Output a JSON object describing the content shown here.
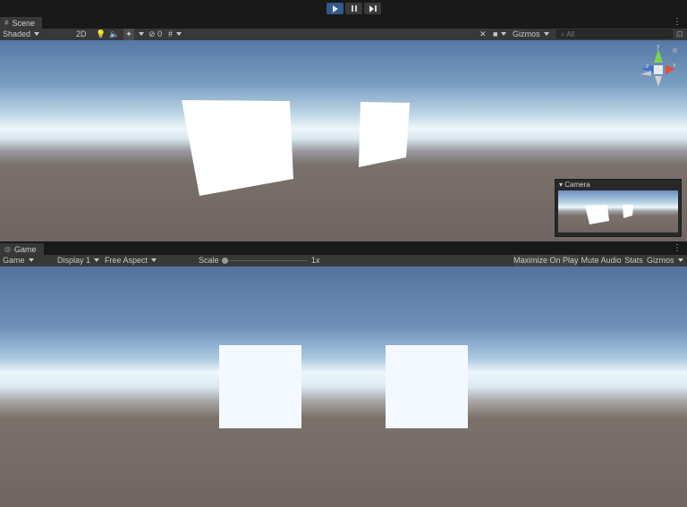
{
  "play_controls": {
    "play_label": "Play",
    "pause_label": "Pause",
    "step_label": "Step"
  },
  "scene_panel": {
    "tab_label": "Scene",
    "toolbar": {
      "shading_mode": "Shaded",
      "mode_2d": "2D",
      "hidden_count": "0",
      "gizmos_label": "Gizmos",
      "search_placeholder": "All"
    },
    "gizmo_axes": {
      "x": "x",
      "y": "y",
      "z": "z"
    },
    "camera_preview_title": "Camera"
  },
  "game_panel": {
    "tab_label": "Game",
    "toolbar": {
      "view_mode": "Game",
      "display": "Display 1",
      "aspect": "Free Aspect",
      "scale_label": "Scale",
      "scale_value": 0.0,
      "scale_readout": "1x",
      "maximize_label": "Maximize On Play",
      "mute_label": "Mute Audio",
      "stats_label": "Stats",
      "gizmos_label": "Gizmos"
    }
  },
  "colors": {
    "play_active": "#2f5c8a",
    "panel_bg": "#383838",
    "window_bg": "#191919"
  }
}
